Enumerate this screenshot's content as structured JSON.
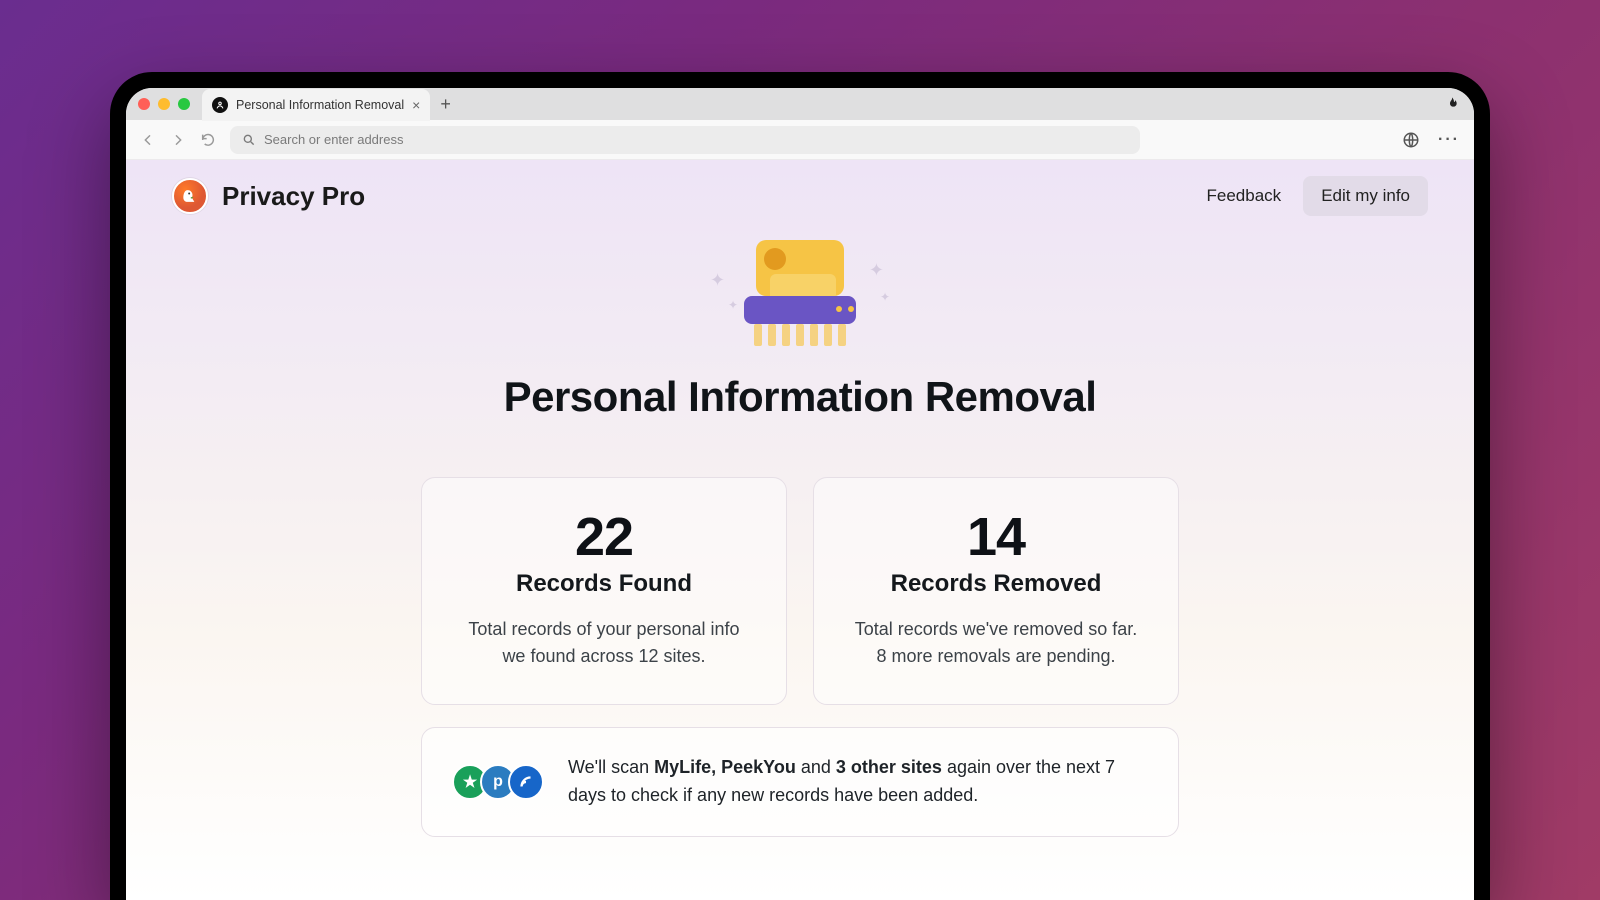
{
  "browser": {
    "tab_title": "Personal Information Removal",
    "search_placeholder": "Search or enter address"
  },
  "header": {
    "brand": "Privacy Pro",
    "feedback": "Feedback",
    "edit_button": "Edit my info"
  },
  "hero": {
    "title": "Personal Information Removal"
  },
  "stats": {
    "found": {
      "value": "22",
      "label": "Records Found",
      "desc": "Total records of your personal info we found across 12 sites."
    },
    "removed": {
      "value": "14",
      "label": "Records Removed",
      "desc": "Total records we've removed so far. 8 more removals are pending."
    }
  },
  "scan": {
    "prefix": "We'll scan ",
    "sites_bold": "MyLife, PeekYou",
    "mid": " and ",
    "count_bold": "3 other sites",
    "suffix": " again over the next 7 days to check if any new records have been added."
  }
}
